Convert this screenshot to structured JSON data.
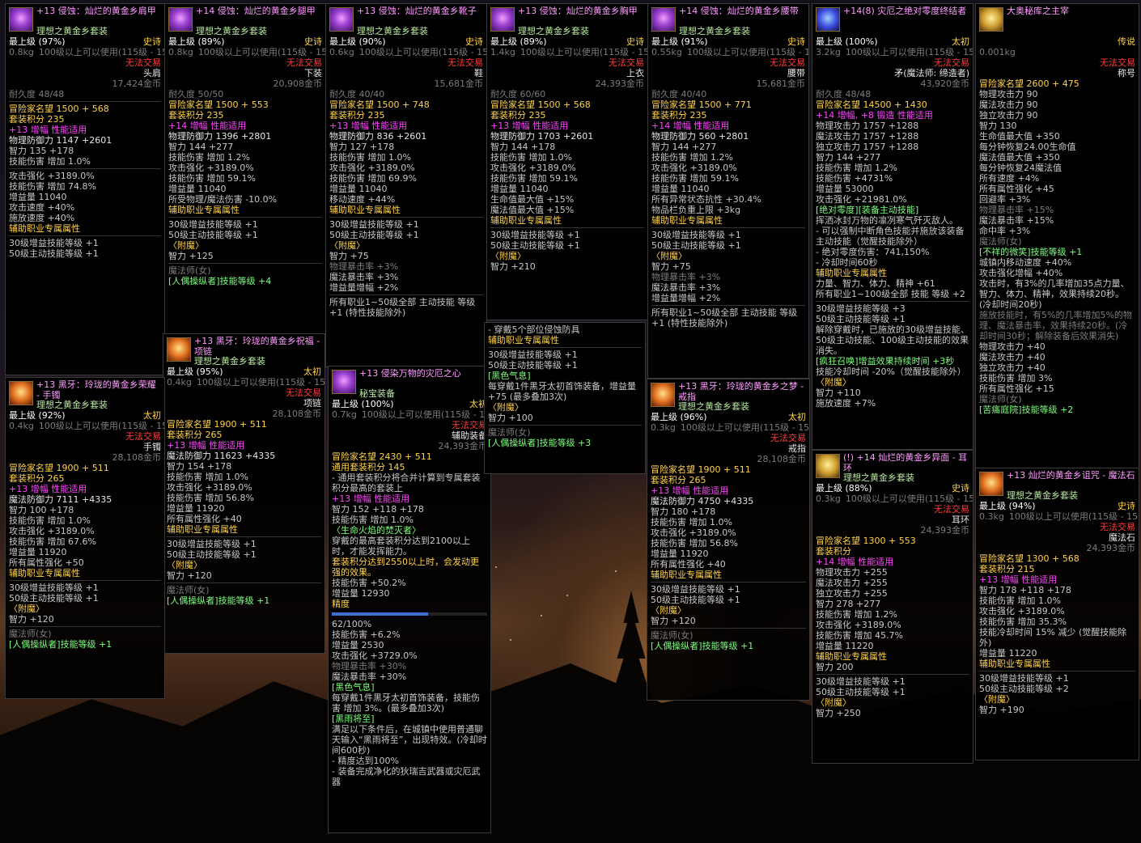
{
  "panels": [
    {
      "id": "p1",
      "icon": "purple",
      "title": "+13 侵蚀：灿烂的黄金乡肩甲",
      "sub": "理想之黄金乡套装",
      "level": "最上级 (97%)",
      "rarity": "史诗",
      "weight": "0.8kg",
      "req": "100级以上可以使用(115级 - 15)",
      "trade": "无法交易",
      "slot": "头肩",
      "price": "17,424金币",
      "lines": [
        "耐久度 48/48",
        "",
        "冒险家名望 1500 + 568",
        "套装积分 235",
        "+13 增幅 性能适用",
        "物理防御力 1147 +2601",
        "智力 135 +178",
        "技能伤害 增加 1.0%",
        "",
        "攻击强化 +3189.0%",
        "技能伤害 增加 74.8%",
        "增益量 11040",
        "攻击速度 +40%",
        "施放速度 +40%",
        "辅助职业专属属性",
        "",
        "30级增益技能等级 +1",
        "50级主动技能等级 +1"
      ]
    },
    {
      "id": "p2",
      "icon": "purple",
      "title": "+14 侵蚀：灿烂的黄金乡腿甲",
      "sub": "理想之黄金乡套装",
      "level": "最上级 (89%)",
      "rarity": "史诗",
      "weight": "0.8kg",
      "req": "100级以上可以使用(115级 - 15)",
      "trade": "无法交易",
      "slot": "下装",
      "price": "20,908金币",
      "lines": [
        "耐久度 50/50",
        "冒险家名望 1500 + 553",
        "套装积分 235",
        "+14 增幅 性能适用",
        "物理防御力 1396 +2801",
        "智力 144 +277",
        "技能伤害 增加 1.2%",
        "攻击强化 +3189.0%",
        "技能伤害 增加 59.1%",
        "增益量 11040",
        "所受物理/魔法伤害 -10.0%",
        "辅助职业专属属性",
        "",
        "30级增益技能等级 +1",
        "50级主动技能等级 +1",
        "〈附魔〉",
        "智力 +125",
        "",
        "魔法师(女)",
        "[人偶操纵者]技能等级 +4"
      ]
    },
    {
      "id": "p3",
      "icon": "purple",
      "title": "+13 侵蚀：灿烂的黄金乡靴子",
      "sub": "理想之黄金乡套装",
      "level": "最上级 (90%)",
      "rarity": "史诗",
      "weight": "0.6kg",
      "req": "100级以上可以使用(115级 - 15)",
      "trade": "无法交易",
      "slot": "鞋",
      "price": "15,681金币",
      "lines": [
        "耐久度 40/40",
        "冒险家名望 1500 + 748",
        "套装积分 235",
        "+13 增幅 性能适用",
        "物理防御力 836 +2601",
        "智力 127 +178",
        "技能伤害 增加 1.0%",
        "攻击强化 +3189.0%",
        "技能伤害 增加 69.9%",
        "增益量 11040",
        "移动速度 +44%",
        "辅助职业专属属性",
        "",
        "30级增益技能等级 +1",
        "50级主动技能等级 +1",
        "〈附魔〉",
        "智力 +75",
        "物理暴击率 +3%",
        "魔法暴击率 +3%",
        "增益量增幅 +2%",
        "",
        "所有职业1~50级全部 主动技能 等级+1 (特性技能除外)"
      ]
    },
    {
      "id": "p4",
      "icon": "purple",
      "title": "+13 侵蚀：灿烂的黄金乡胸甲",
      "sub": "理想之黄金乡套装",
      "level": "最上级 (89%)",
      "rarity": "史诗",
      "weight": "1.4kg",
      "req": "100级以上可以使用(115级 - 15)",
      "trade": "无法交易",
      "slot": "上衣",
      "price": "24,393金币",
      "lines": [
        "耐久度 60/60",
        "冒险家名望 1500 + 568",
        "套装积分 235",
        "+13 增幅 性能适用",
        "物理防御力 1703 +2601",
        "智力 144 +178",
        "技能伤害 增加 1.0%",
        "攻击强化 +3189.0%",
        "技能伤害 增加 59.1%",
        "增益量 11040",
        "生命值最大值 +15%",
        "魔法值最大值 +15%",
        "辅助职业专属属性",
        "",
        "30级增益技能等级 +1",
        "50级主动技能等级 +1",
        "〈附魔〉",
        "智力 +210"
      ]
    },
    {
      "id": "p5",
      "icon": "purple",
      "title": "+14 侵蚀：灿烂的黄金乡腰带",
      "sub": "理想之黄金乡套装",
      "level": "最上级 (91%)",
      "rarity": "史诗",
      "weight": "0.55kg",
      "req": "100级以上可以使用(115级 - 15)",
      "trade": "无法交易",
      "slot": "腰带",
      "price": "15,681金币",
      "lines": [
        "耐久度 40/40",
        "冒险家名望 1500 + 771",
        "套装积分 235",
        "+14 增幅 性能适用",
        "物理防御力 560 +2801",
        "智力 144 +277",
        "技能伤害 增加 1.2%",
        "攻击强化 +3189.0%",
        "技能伤害 增加 59.1%",
        "增益量 11040",
        "所有异常状态抗性 +30.4%",
        "物品栏负重上限 +3kg",
        "辅助职业专属属性",
        "",
        "30级增益技能等级 +1",
        "50级主动技能等级 +1",
        "〈附魔〉",
        "智力 +75",
        "物理暴击率 +3%",
        "魔法暴击率 +3%",
        "增益量增幅 +2%",
        "",
        "所有职业1~50级全部 主动技能 等级+1 (特性技能除外)"
      ]
    },
    {
      "id": "p6",
      "icon": "blue",
      "title": "+14(8) 灾厄之绝对零度终结者",
      "sub": "",
      "level": "最上级 (100%)",
      "rarity": "太初",
      "weight": "3.2kg",
      "req": "100级以上可以使用(115级 - 15)",
      "trade": "无法交易",
      "slot": "矛(魔法师: 缔造者)",
      "price": "43,920金币",
      "lines": [
        "耐久度 48/48",
        "冒险家名望 14500 + 1430",
        "+14 增幅, +8 锻造 性能适用",
        "物理攻击力 1757 +1288",
        "魔法攻击力 1757 +1288",
        "独立攻击力 1757 +1288",
        "智力 144 +277",
        "技能伤害 增加 1.2%",
        "技能伤害 +4731%",
        "增益量 53000",
        "攻击强化 +21981.0%",
        "[绝对零度][装备主动技能]",
        "挥洒冰封万物的凛冽寒气歼灭敌人。",
        "- 可以强制中断角色技能并施放该装备主动技能（觉醒技能除外）",
        "- 绝对零度伤害：741,150%",
        "- 冷却时间60秒",
        "辅助职业专属属性",
        "力量、智力、体力、精神 +61",
        "所有职业1~100级全部 技能 等级 +2",
        "",
        "30级增益技能等级 +3",
        "50级主动技能等级 +1",
        "解除穿戴时，已施放的30级增益技能、50级主动技能、100级主动技能的效果消失。",
        "[疯狂召唤]增益效果持续时间 +3秒",
        "技能冷却时间 -20%（觉醒技能除外）",
        "〈附魔〉",
        "智力 +110",
        "施放速度 +7%"
      ]
    },
    {
      "id": "p7",
      "icon": "gold",
      "title": "大奥秘库之主宰",
      "sub": "",
      "level": "",
      "rarity": "传说",
      "weight": "0.001kg",
      "req": "",
      "trade": "无法交易",
      "slot": "称号",
      "price": "",
      "lines": [
        "冒险家名望 2600 + 475",
        "物理攻击力 90",
        "魔法攻击力 90",
        "独立攻击力 90",
        "智力 130",
        "生命值最大值 +350",
        "每分钟恢复24.00生命值",
        "魔法值最大值 +350",
        "每分钟恢复24魔法值",
        "所有速度 +4%",
        "所有属性强化 +45",
        "回避率 +3%",
        "物理暴击率 +15%",
        "魔法暴击率 +15%",
        "命中率 +3%",
        "魔法师(女)",
        "[不祥的微笑]技能等级 +1",
        "城镇内移动速度 +40%",
        "攻击强化增幅 +40%",
        "攻击时，有3%的几率增加35点力量、智力、体力、精神，效果持续20秒。(冷却时间20秒)",
        "施放技能时，有5%的几率增加5%的物理、魔法暴击率，效果持续20秒。(冷却时间30秒；解除装备后效果消失)",
        "物理攻击力 +40",
        "魔法攻击力 +40",
        "独立攻击力 +40",
        "技能伤害 增加 3%",
        "所有属性强化 +15",
        "魔法师(女)",
        "[苦痛庭院]技能等级 +2"
      ]
    },
    {
      "id": "p8",
      "icon": "orange",
      "title": "+13 黑牙：玲珑的黄金乡祝福 - 项链",
      "sub": "理想之黄金乡套装",
      "level": "最上级 (95%)",
      "rarity": "太初",
      "weight": "0.4kg",
      "req": "100级以上可以使用(115级 - 15)",
      "trade": "无法交易",
      "slot": "项链",
      "price": "28,108金币",
      "lines": [
        "冒险家名望 1900 + 511",
        "套装积分 265",
        "+13 增幅 性能适用",
        "魔法防御力 11623 +4335",
        "智力 154 +178",
        "技能伤害 增加 1.0%",
        "攻击强化 +3189.0%",
        "技能伤害 增加 56.8%",
        "增益量 11920",
        "所有属性强化 +40",
        "辅助职业专属属性",
        "",
        "30级增益技能等级 +1",
        "50级主动技能等级 +1",
        "〈附魔〉",
        "智力 +120",
        "",
        "魔法师(女)",
        "[人偶操纵者]技能等级 +1"
      ]
    },
    {
      "id": "p9",
      "icon": "orange",
      "title": "+13 黑牙：玲珑的黄金乡荣耀 - 手镯",
      "sub": "理想之黄金乡套装",
      "level": "最上级 (92%)",
      "rarity": "太初",
      "weight": "0.4kg",
      "req": "100级以上可以使用(115级 - 15)",
      "trade": "无法交易",
      "slot": "手镯",
      "price": "28,108金币",
      "lines": [
        "冒险家名望 1900 + 511",
        "套装积分 265",
        "+13 增幅 性能适用",
        "魔法防御力 7111 +4335",
        "智力 100 +178",
        "技能伤害 增加 1.0%",
        "攻击强化 +3189.0%",
        "技能伤害 增加 67.6%",
        "增益量 11920",
        "所有属性强化 +50",
        "辅助职业专属属性",
        "",
        "30级增益技能等级 +1",
        "50级主动技能等级 +1",
        "〈附魔〉",
        "智力 +120",
        "",
        "魔法师(女)",
        "[人偶操纵者]技能等级 +1"
      ]
    },
    {
      "id": "p10",
      "icon": "purple",
      "title": "+13 侵染万物的灾厄之心",
      "sub": "秘宝装备",
      "level": "最上级 (100%)",
      "rarity": "太初",
      "weight": "0.7kg",
      "req": "100级以上可以使用(115级 - 15)",
      "trade": "无法交易",
      "slot": "辅助装备",
      "price": "24,393金币",
      "lines": [
        "冒险家名望 2430 + 511",
        "通用套装积分 145",
        "- 通用套装积分将合并计算到专属套装积分最高的套装上",
        "+13 增幅 性能适用",
        "智力 152 +118 +178",
        "技能伤害 增加 1.0%",
        "〈生命火焰的焚灭者〉",
        "穿戴的最高套装积分达到2100以上时，才能发挥能力。",
        "套装积分达到2550以上时，会发动更强的效果。",
        "技能伤害 +50.2%",
        "增益量 12930",
        "精度",
        "62/100%",
        "技能伤害 +6.2%",
        "增益量 2530",
        "攻击强化 +3729.0%",
        "物理暴击率 +30%",
        "魔法暴击率 +30%",
        "[黑色气息]",
        "每穿戴1件黑牙太初首饰装备，技能伤害 增加 3%。(最多叠加3次)",
        "[黑雨将至]",
        "满足以下条件后，在城镇中使用普通聊天输入“黑雨将至”，出现特效。(冷却时间600秒)",
        "- 精度达到100%",
        "- 装备完成净化的狄瑞吉武器或灾厄武器"
      ]
    },
    {
      "id": "p11",
      "icon": "",
      "title": "",
      "sub": "",
      "level": "",
      "rarity": "",
      "weight": "",
      "req": "",
      "trade": "",
      "slot": "",
      "price": "",
      "lines": [
        "- 穿戴5个部位侵蚀防具",
        "辅助职业专属属性",
        "",
        "30级增益技能等级 +1",
        "50级主动技能等级 +1",
        "[黑色气息]",
        "每穿戴1件黑牙太初首饰装备，增益量 +75 (最多叠加3次)",
        "〈附魔〉",
        "智力 +100",
        "",
        "魔法师(女)",
        "[人偶操纵者]技能等级 +3"
      ]
    },
    {
      "id": "p12",
      "icon": "orange",
      "title": "+13 黑牙：玲珑的黄金乡之梦 - 戒指",
      "sub": "理想之黄金乡套装",
      "level": "最上级 (96%)",
      "rarity": "太初",
      "weight": "0.3kg",
      "req": "100级以上可以使用(115级 - 15)",
      "trade": "无法交易",
      "slot": "戒指",
      "price": "28,108金币",
      "lines": [
        "冒险家名望 1900 + 511",
        "套装积分 265",
        "+13 增幅 性能适用",
        "魔法防御力 4750 +4335",
        "智力 180 +178",
        "技能伤害 增加 1.0%",
        "攻击强化 +3189.0%",
        "技能伤害 增加 56.8%",
        "增益量 11920",
        "所有属性强化 +40",
        "辅助职业专属属性",
        "",
        "30级增益技能等级 +1",
        "50级主动技能等级 +1",
        "〈附魔〉",
        "智力 +120",
        "",
        "魔法师(女)",
        "[人偶操纵者]技能等级 +1"
      ]
    },
    {
      "id": "p13",
      "icon": "gold",
      "title": "(!) +14 灿烂的黄金乡异面 - 耳环",
      "sub": "理想之黄金乡套装",
      "level": "最上级 (88%)",
      "rarity": "史诗",
      "weight": "0.3kg",
      "req": "100级以上可以使用(115级 - 15)",
      "trade": "无法交易",
      "slot": "耳环",
      "price": "24,393金币",
      "lines": [
        "冒险家名望 1300 + 553",
        "套装积分",
        "+14 增幅 性能适用",
        "物理攻击力 +255",
        "魔法攻击力 +255",
        "独立攻击力 +255",
        "智力 278 +277",
        "技能伤害 增加 1.2%",
        "攻击强化 +3189.0%",
        "技能伤害 增加 45.7%",
        "增益量 11220",
        "辅助职业专属属性",
        "智力 200",
        "",
        "30级增益技能等级 +1",
        "50级主动技能等级 +1",
        "〈附魔〉",
        "智力 +250"
      ]
    },
    {
      "id": "p14",
      "icon": "orange",
      "title": "+13 灿烂的黄金乡诅咒 - 魔法石",
      "sub": "理想之黄金乡套装",
      "level": "最上级 (94%)",
      "rarity": "史诗",
      "weight": "0.3kg",
      "req": "100级以上可以使用(115级 - 15)",
      "trade": "无法交易",
      "slot": "魔法石",
      "price": "24,393金币",
      "lines": [
        "冒险家名望 1300 + 568",
        "套装积分 215",
        "+13 增幅 性能适用",
        "智力 178 +118 +178",
        "技能伤害 增加 1.0%",
        "攻击强化 +3189.0%",
        "技能伤害 增加 35.3%",
        "技能冷却时间 15% 减少 (觉醒技能除外)",
        "增益量 11220",
        "辅助职业专属属性",
        "",
        "30级增益技能等级 +1",
        "50级主动技能等级 +2",
        "〈附魔〉",
        "智力 +190"
      ]
    }
  ]
}
